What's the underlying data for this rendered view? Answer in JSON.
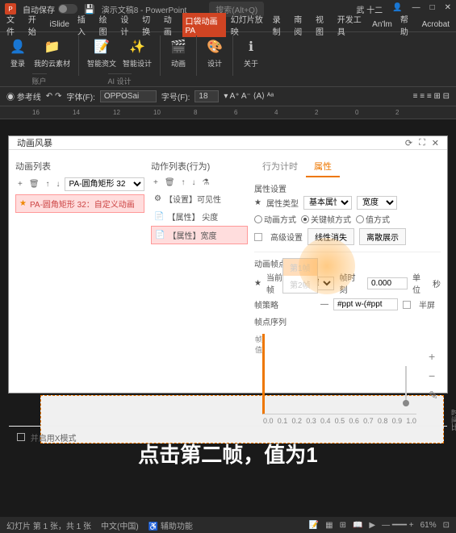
{
  "titlebar": {
    "autosave": "自动保存",
    "doc": "演示文稿8 - PowerPoint",
    "search": "搜索(Alt+Q)",
    "user": "武 十二"
  },
  "menu": {
    "items": [
      "文件",
      "开始",
      "iSlide",
      "插入",
      "绘图",
      "设计",
      "切换",
      "动画",
      "口袋动画 PA",
      "幻灯片放映",
      "录制",
      "南阅",
      "视图",
      "开发工具",
      "An'lm",
      "帮助",
      "Acrobat"
    ],
    "active": 8
  },
  "ribbon": {
    "g1": {
      "b1": "登录",
      "b2": "我的云素材",
      "label": "账户"
    },
    "g2": {
      "b1": "智能资文",
      "b2": "智能设计",
      "label": "AI 设计"
    },
    "g3": {
      "b1": "动画",
      "label": ""
    },
    "g4": {
      "b1": "设计",
      "label": ""
    },
    "g5": {
      "b1": "关于",
      "label": ""
    }
  },
  "toolbar2": {
    "refline": "参考线",
    "font_label": "字体(F):",
    "font": "OPPOSai",
    "size_label": "字号(F):",
    "size": "18"
  },
  "dialog": {
    "title": "动画风暴",
    "panel1": {
      "header": "动画列表",
      "shape": "PA-圆角矩形 32",
      "item": "PA-圆角矩形 32：自定义动画"
    },
    "panel2": {
      "header": "动作列表(行为)",
      "a1": "【设置】可见性",
      "a2": "【属性】 尖度",
      "a3": "【属性】宽度"
    },
    "panel3": {
      "tab1": "行为计时",
      "tab2": "属性",
      "sec1": "属性设置",
      "type_label": "属性类型",
      "type": "基本属性",
      "val": "宽度",
      "mode_label": "动画方式",
      "m1": "关键帧方式",
      "m2": "值方式",
      "adv": "高级设置",
      "btn1": "线性消失",
      "btn2": "离散展示",
      "sec2": "动画帧点设置",
      "cur": "当前帧",
      "frame": "第1帧",
      "time_label": "帧时刻",
      "time": "0.000",
      "unit": "单位",
      "unit_v": "秒",
      "dd1": "第1帧",
      "dd2": "第2帧",
      "route": "帧策略",
      "route_v": "#ppt w-(#ppt",
      "half": "半屏",
      "axis": "帧点序列",
      "y1": "帧",
      "y2": "值",
      "x": [
        "0.0",
        "0.1",
        "0.2",
        "0.3",
        "0.4",
        "0.5",
        "0.6",
        "0.7",
        "0.8",
        "0.9",
        "1.0"
      ],
      "tools": {
        "plus": "+",
        "minus": "−",
        "pen": "✎",
        "clock": "时间比"
      }
    },
    "footer": "并启用X模式"
  },
  "subtitle": "点击第二帧，值为1",
  "status": {
    "slide": "幻灯片 第 1 张，共 1 张",
    "lang": "中文(中国)",
    "access": "辅助功能",
    "zoom": "61%"
  },
  "chart_data": {
    "type": "line",
    "title": "帧点序列",
    "xlabel": "时间",
    "ylabel": "值",
    "x": [
      0.0
    ],
    "values": [
      0
    ],
    "xlim": [
      0,
      1
    ],
    "xticks": [
      0.0,
      0.1,
      0.2,
      0.3,
      0.4,
      0.5,
      0.6,
      0.7,
      0.8,
      0.9,
      1.0
    ]
  }
}
